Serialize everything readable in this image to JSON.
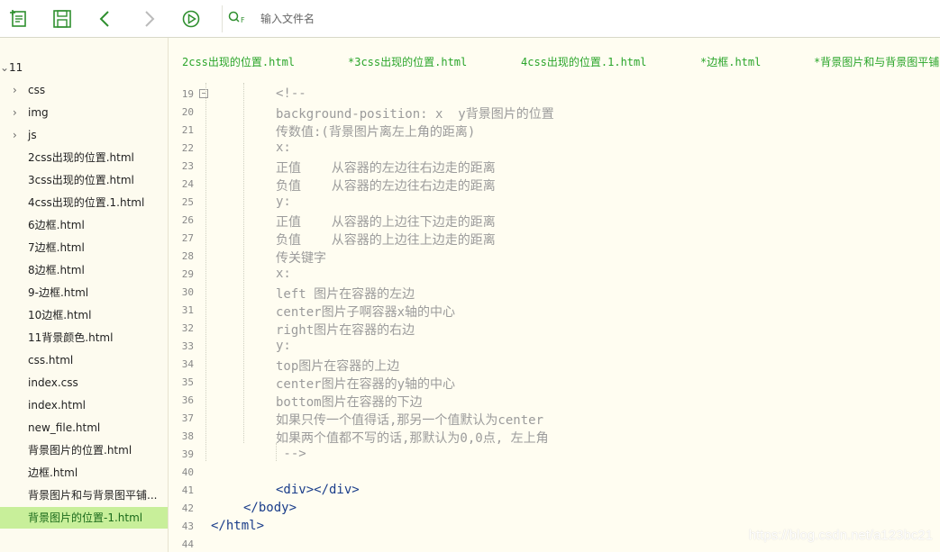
{
  "toolbar": {
    "search_placeholder": "输入文件名",
    "search_icon_text": "Q F"
  },
  "sidebar": {
    "root": "11",
    "folders": [
      "css",
      "img",
      "js"
    ],
    "files": [
      "2css出现的位置.html",
      "3css出现的位置.html",
      "4css出现的位置.1.html",
      "6边框.html",
      "7边框.html",
      "8边框.html",
      "9-边框.html",
      "10边框.html",
      "11背景颜色.html",
      "css.html",
      "index.css",
      "index.html",
      "new_file.html",
      "背景图片的位置.html",
      "边框.html",
      "背景图片和与背景图平铺...",
      "背景图片的位置-1.html"
    ],
    "selected_index": 16
  },
  "tabs": [
    "2css出现的位置.html",
    "*3css出现的位置.html",
    "4css出现的位置.1.html",
    "*边框.html",
    "*背景图片和与背景图平铺"
  ],
  "editor": {
    "lines": [
      {
        "n": "19",
        "text": "<!--"
      },
      {
        "n": "20",
        "text": "background-position: x  y背景图片的位置"
      },
      {
        "n": "21",
        "text": "传数值:(背景图片离左上角的距离)"
      },
      {
        "n": "22",
        "text": "x:"
      },
      {
        "n": "23",
        "text": "正值    从容器的左边往右边走的距离"
      },
      {
        "n": "24",
        "text": "负值    从容器的左边往右边走的距离"
      },
      {
        "n": "25",
        "text": "y:"
      },
      {
        "n": "26",
        "text": "正值    从容器的上边往下边走的距离"
      },
      {
        "n": "27",
        "text": "负值    从容器的上边往上边走的距离"
      },
      {
        "n": "28",
        "text": "传关键字"
      },
      {
        "n": "29",
        "text": "x:"
      },
      {
        "n": "30",
        "text": "left 图片在容器的左边"
      },
      {
        "n": "31",
        "text": "center图片子啊容器x轴的中心"
      },
      {
        "n": "32",
        "text": "right图片在容器的右边"
      },
      {
        "n": "33",
        "text": "y:"
      },
      {
        "n": "34",
        "text": "top图片在容器的上边"
      },
      {
        "n": "35",
        "text": "center图片在容器的y轴的中心"
      },
      {
        "n": "36",
        "text": "bottom图片在容器的下边"
      },
      {
        "n": "37",
        "text": "如果只传一个值得话,那另一个值默认为center"
      },
      {
        "n": "38",
        "text": "如果两个值都不写的话,那默认为0,0点, 左上角"
      },
      {
        "n": "39",
        "text": " -->"
      },
      {
        "n": "40",
        "text": ""
      },
      {
        "n": "41",
        "text": "<div></div>"
      },
      {
        "n": "42",
        "text": "</body>"
      },
      {
        "n": "43",
        "text": "</html>"
      },
      {
        "n": "44",
        "text": ""
      }
    ]
  },
  "watermark": "https://blog.csdn.net/a123bc21",
  "colors": {
    "accent": "#2aa52a",
    "selected_bg": "#c8ef9a",
    "comment": "#9b9b9b",
    "tag": "#1a3d8a",
    "background": "#fffdf1"
  }
}
